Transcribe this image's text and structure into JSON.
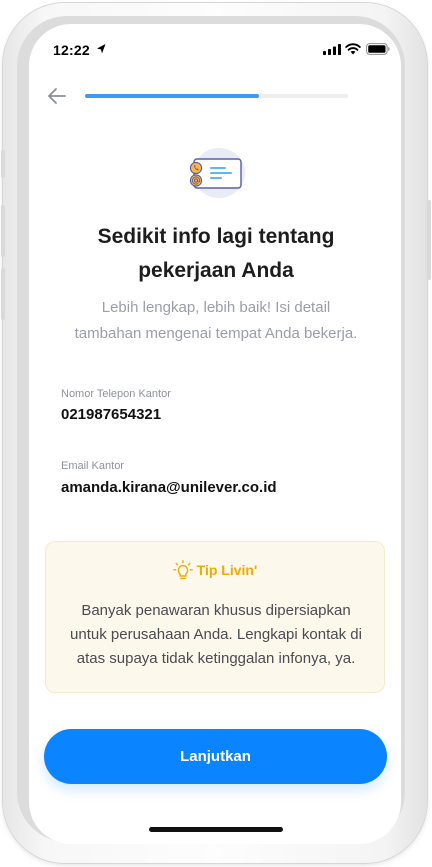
{
  "status_bar": {
    "time": "12:22"
  },
  "progress": {
    "fraction": 0.66
  },
  "heading": {
    "title_line1": "Sedikit info lagi tentang",
    "title_line2": "pekerjaan Anda",
    "subtitle_line1": "Lebih lengkap, lebih baik! Isi detail",
    "subtitle_line2": "tambahan mengenai tempat Anda bekerja."
  },
  "fields": {
    "office_phone": {
      "label": "Nomor Telepon Kantor",
      "value": "021987654321"
    },
    "office_email": {
      "label": "Email Kantor",
      "value": "amanda.kirana@unilever.co.id"
    }
  },
  "tip": {
    "title": "Tip Livin'",
    "line1": "Banyak penawaran khusus dipersiapkan",
    "line2": "untuk perusahaan Anda. Lengkapi kontak di",
    "line3": "atas supaya tidak ketinggalan infonya, ya."
  },
  "button": {
    "label": "Lanjutkan"
  },
  "icons": {
    "back": "arrow-left-icon",
    "illustration": "contact-card-icon",
    "tip": "lightbulb-icon"
  },
  "colors": {
    "primary": "#0a84ff",
    "progress": "#3d9bf6",
    "tip_accent": "#f2a900",
    "tip_background": "#fdf8ec"
  }
}
